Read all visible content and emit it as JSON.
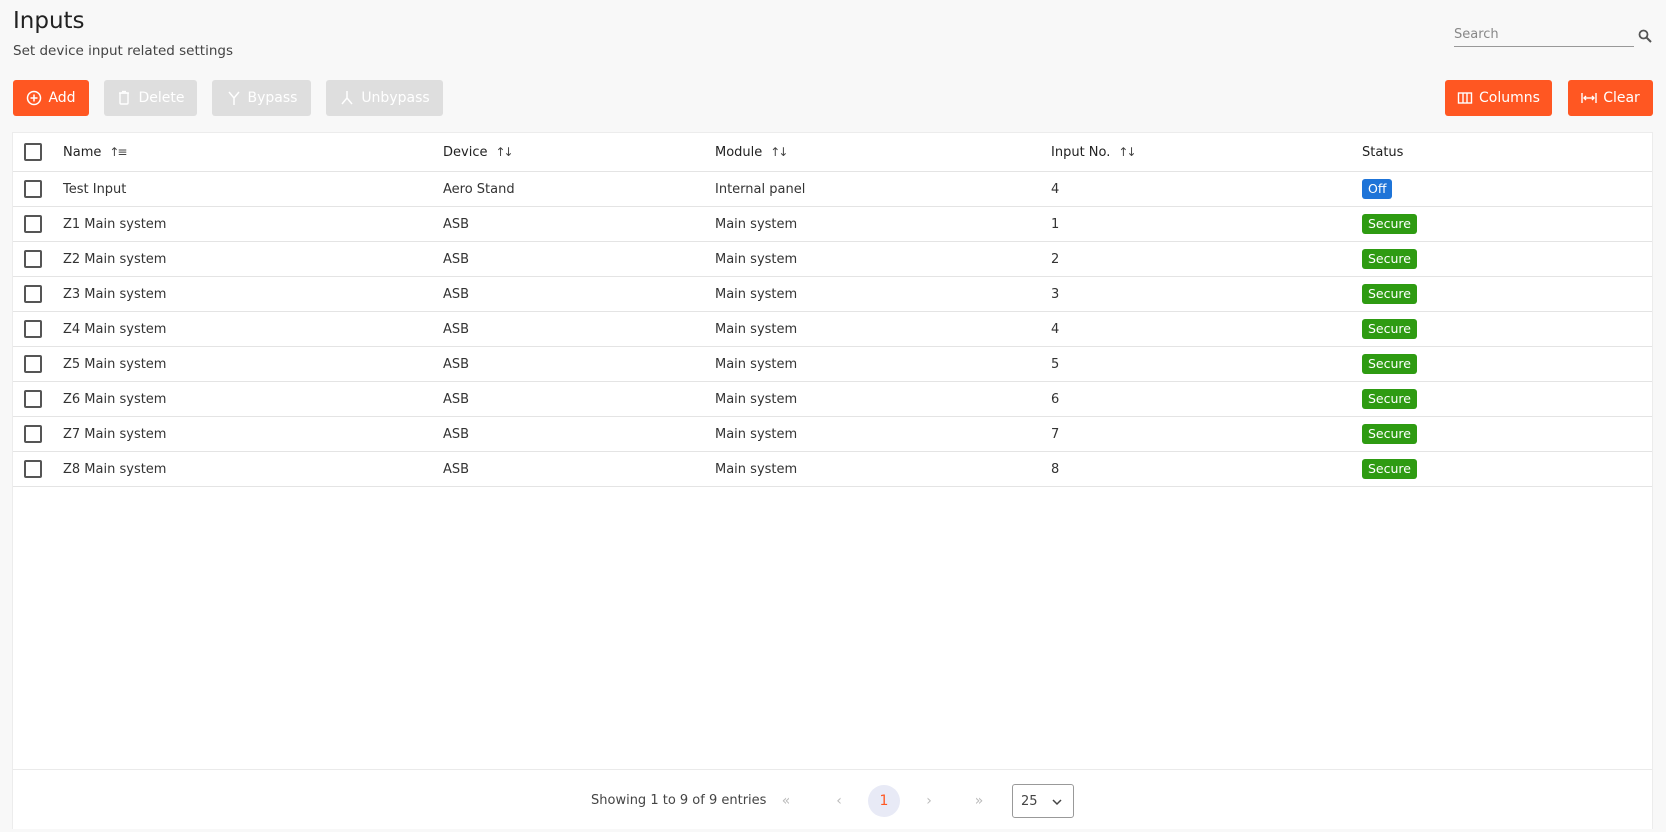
{
  "header": {
    "title": "Inputs",
    "subtitle": "Set device input related settings"
  },
  "search": {
    "placeholder": "Search",
    "icon": "search-icon"
  },
  "toolbar": {
    "add_label": "Add",
    "delete_label": "Delete",
    "bypass_label": "Bypass",
    "unbypass_label": "Unbypass",
    "columns_label": "Columns",
    "clear_label": "Clear"
  },
  "colors": {
    "accent": "#ff5722",
    "disabled": "#dedede",
    "status_off": "#1e74d8",
    "status_secure": "#2e9b12"
  },
  "table": {
    "columns": [
      {
        "label": "Name",
        "sort": "sorted-asc"
      },
      {
        "label": "Device",
        "sort": "sortable"
      },
      {
        "label": "Module",
        "sort": "sortable"
      },
      {
        "label": "Input No.",
        "sort": "sortable"
      },
      {
        "label": "Status",
        "sort": "none"
      }
    ],
    "rows": [
      {
        "name": "Test Input",
        "device": "Aero Stand",
        "module": "Internal panel",
        "input_no": "4",
        "status": "Off"
      },
      {
        "name": "Z1 Main system",
        "device": "ASB",
        "module": "Main system",
        "input_no": "1",
        "status": "Secure"
      },
      {
        "name": "Z2 Main system",
        "device": "ASB",
        "module": "Main system",
        "input_no": "2",
        "status": "Secure"
      },
      {
        "name": "Z3 Main system",
        "device": "ASB",
        "module": "Main system",
        "input_no": "3",
        "status": "Secure"
      },
      {
        "name": "Z4 Main system",
        "device": "ASB",
        "module": "Main system",
        "input_no": "4",
        "status": "Secure"
      },
      {
        "name": "Z5 Main system",
        "device": "ASB",
        "module": "Main system",
        "input_no": "5",
        "status": "Secure"
      },
      {
        "name": "Z6 Main system",
        "device": "ASB",
        "module": "Main system",
        "input_no": "6",
        "status": "Secure"
      },
      {
        "name": "Z7 Main system",
        "device": "ASB",
        "module": "Main system",
        "input_no": "7",
        "status": "Secure"
      },
      {
        "name": "Z8 Main system",
        "device": "ASB",
        "module": "Main system",
        "input_no": "8",
        "status": "Secure"
      }
    ]
  },
  "pagination": {
    "entries_text": "Showing 1 to 9 of 9 entries",
    "first": "«",
    "prev": "‹",
    "current_page": "1",
    "next": "›",
    "last": "»",
    "page_size": "25"
  }
}
